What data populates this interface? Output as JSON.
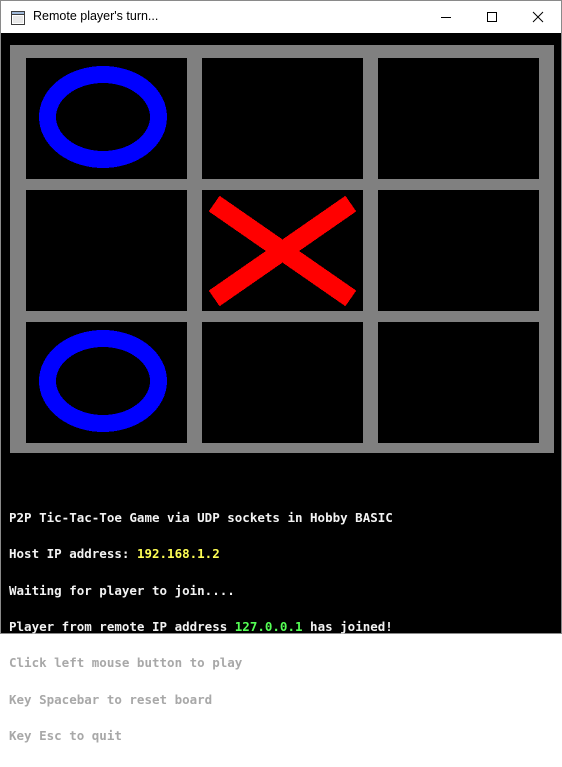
{
  "window": {
    "title": "Remote player's turn..."
  },
  "icons": {
    "app": "app-window-icon",
    "minimize": "minimize-icon",
    "maximize": "maximize-icon",
    "close": "close-icon"
  },
  "colors": {
    "board_grid": "#808080",
    "cell_background": "#000000",
    "o_mark": "#0000ff",
    "x_mark": "#ff0000",
    "text_white": "#f2f2f2",
    "text_gray": "#a8a8a8",
    "text_yellow": "#ffff55",
    "text_green": "#55ff55"
  },
  "board": {
    "cells": [
      "O",
      "",
      "",
      "",
      "X",
      "",
      "O",
      "",
      ""
    ]
  },
  "console": {
    "line1": "P2P Tic-Tac-Toe Game via UDP sockets in Hobby BASIC",
    "host_label": "Host IP address: ",
    "host_ip": "192.168.1.2",
    "waiting": "Waiting for player to join....",
    "remote_prefix": "Player from remote IP address ",
    "remote_ip": "127.0.0.1",
    "remote_suffix": " has joined!",
    "hint_click": "Click left mouse button to play",
    "hint_reset": "Key Spacebar to reset board",
    "hint_quit": "Key Esc to quit"
  }
}
